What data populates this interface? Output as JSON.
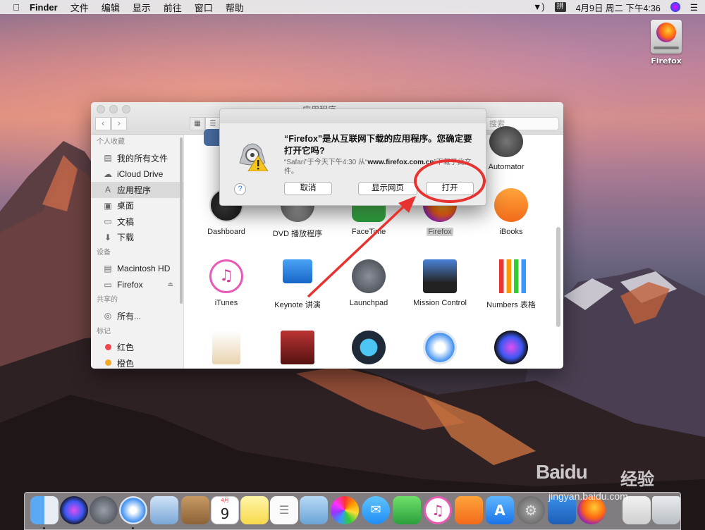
{
  "menubar": {
    "app_name": "Finder",
    "items": [
      "文件",
      "编辑",
      "显示",
      "前往",
      "窗口",
      "帮助"
    ],
    "input_method": "拼",
    "clock": "4月9日 周二 下午4:36"
  },
  "desktop": {
    "drive_label": "Firefox"
  },
  "finder": {
    "title": "应用程序",
    "search_placeholder": "搜索",
    "sidebar": {
      "favorites_header": "个人收藏",
      "favorites": [
        "我的所有文件",
        "iCloud Drive",
        "应用程序",
        "桌面",
        "文稿",
        "下载"
      ],
      "devices_header": "设备",
      "devices": [
        "Macintosh HD",
        "Firefox"
      ],
      "shared_header": "共享的",
      "shared": [
        "所有..."
      ],
      "tags_header": "标记",
      "tags": [
        "红色",
        "橙色"
      ]
    },
    "apps_row1": [
      "Dashboard",
      "DVD 播放程序",
      "FaceTime",
      "Firefox",
      "iBooks"
    ],
    "top_right_app": "Automator",
    "apps_row2": [
      "iTunes",
      "Keynote 讲演",
      "Launchpad",
      "Mission Control",
      "Numbers 表格"
    ]
  },
  "dialog": {
    "title": "“Firefox”是从互联网下载的应用程序。您确定要打开它吗?",
    "subtitle_prefix": "“Safari”于今天下午4:30 从“",
    "subtitle_domain": "www.firefox.com.cn",
    "subtitle_suffix": "”下载了此文件。",
    "help": "?",
    "cancel": "取消",
    "show_page": "显示网页",
    "open": "打开"
  },
  "dock": {
    "calendar_month": "4月",
    "calendar_day": "9"
  },
  "watermark": {
    "logo": "Baidu",
    "text": "经验",
    "url": "jingyan.baidu.com"
  },
  "colors": {
    "annotation": "#e8322f",
    "selection": "#dadada"
  }
}
